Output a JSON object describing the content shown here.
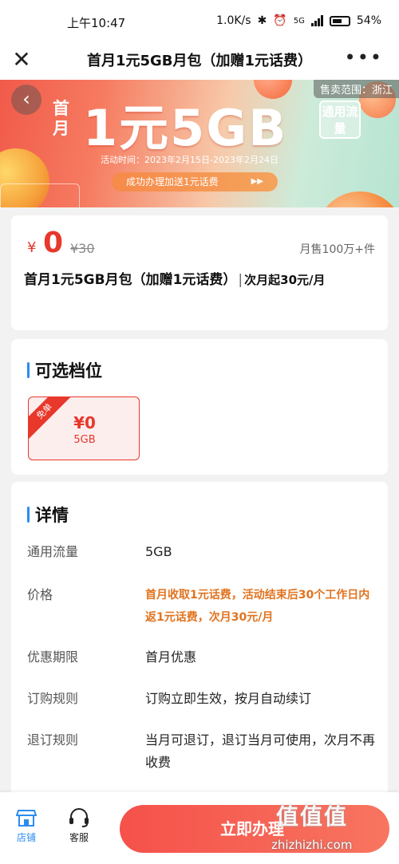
{
  "status_bar": {
    "time": "上午10:47",
    "net_speed": "1.0K/s",
    "network_badge": "5G",
    "battery": "54%"
  },
  "title_bar": {
    "title": "首月1元5GB月包（加赠1元话费）"
  },
  "banner": {
    "prefix": "首月",
    "headline": "1元5GB",
    "tag": "通用流量",
    "date": "活动时间：2023年2月15日-2023年2月24日",
    "cta": "成功办理加送1元话费",
    "region": "售卖范围：浙江"
  },
  "price_card": {
    "currency": "¥",
    "price": "0",
    "original_price": "¥30",
    "monthly_sales": "月售100万+件",
    "product_name": "首月1元5GB月包（加赠1元话费）",
    "renew_note": "次月起30元/月"
  },
  "tiers": {
    "title": "可选档位",
    "options": [
      {
        "ribbon": "免单",
        "price": "¥0",
        "size": "5GB"
      }
    ]
  },
  "details": {
    "title": "详情",
    "rows": [
      {
        "label": "通用流量",
        "value": "5GB"
      },
      {
        "label": "价格",
        "value": "首月收取1元话费，活动结束后30个工作日内返1元话费，次月30元/月"
      },
      {
        "label": "优惠期限",
        "value": "首月优惠"
      },
      {
        "label": "订购规则",
        "value": "订购立即生效，按月自动续订"
      },
      {
        "label": "退订规则",
        "value": "当月可退订，退订当月可使用，次月不再收费"
      }
    ]
  },
  "bottom_bar": {
    "store_label": "店铺",
    "service_label": "客服",
    "buy_label": "立即办理"
  },
  "watermark": {
    "logo": "值值值",
    "url": "zhizhizhi.com"
  },
  "colors": {
    "accent_red": "#e8372b",
    "accent_blue": "#2c8cf0",
    "accent_orange": "#e0731f"
  }
}
